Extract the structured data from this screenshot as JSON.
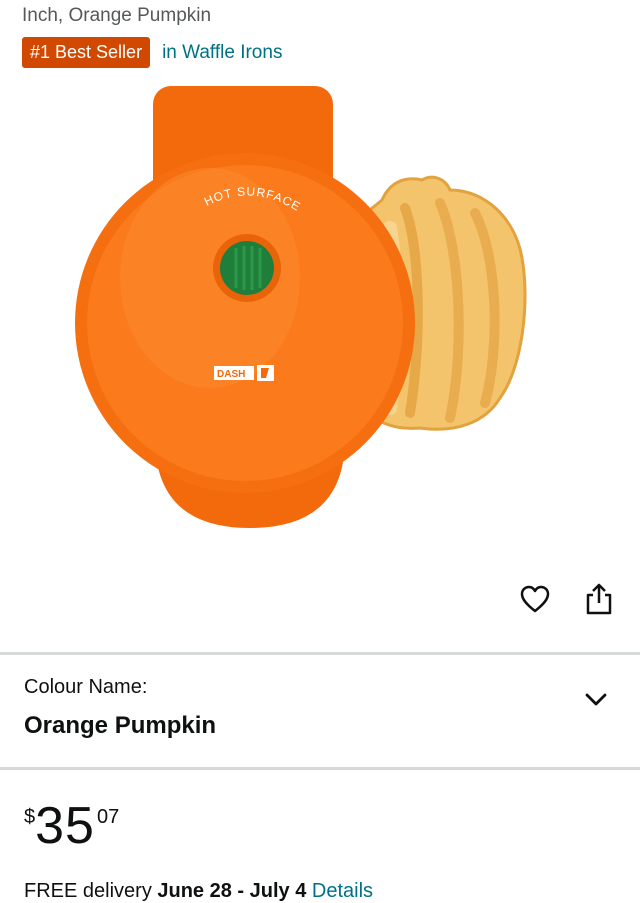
{
  "product": {
    "title_fragment": "Inch, Orange Pumpkin",
    "badge": "#1 Best Seller",
    "category_link": "in Waffle Irons",
    "image_text": {
      "warning": "HOT SURFACE",
      "brand": "DASH"
    }
  },
  "image_actions": {
    "favorite_icon": "heart-icon",
    "share_icon": "share-icon"
  },
  "variant": {
    "label": "Colour Name:",
    "value": "Orange Pumpkin",
    "chevron_icon": "chevron-down-icon"
  },
  "price": {
    "symbol": "$",
    "whole": "35",
    "fraction": "07"
  },
  "delivery": {
    "prefix": "FREE delivery",
    "dates": "June 28 - July 4",
    "details_link": "Details"
  },
  "colors": {
    "badge_bg": "#d14900",
    "link": "#007185",
    "appliance_orange": "#fa6a0d"
  }
}
